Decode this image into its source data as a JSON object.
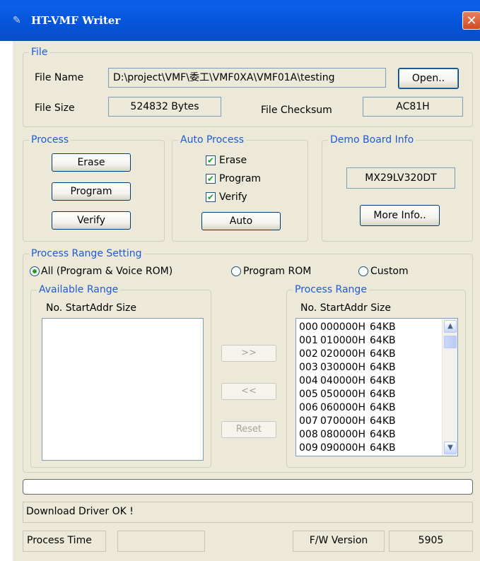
{
  "window": {
    "title": "HT-VMF Writer",
    "close_glyph": "✕",
    "app_icon": "writer-app-icon"
  },
  "file": {
    "legend": "File",
    "name_label": "File Name",
    "name_value": "D:\\project\\VMF\\委工\\VMF0XA\\VMF01A\\testing",
    "open_button": "Open..",
    "size_label": "File Size",
    "size_value": "524832 Bytes",
    "checksum_label": "File Checksum",
    "checksum_value": "AC81H"
  },
  "process": {
    "legend": "Process",
    "erase": "Erase",
    "program": "Program",
    "verify": "Verify"
  },
  "auto_process": {
    "legend": "Auto Process",
    "options": [
      {
        "label": "Erase",
        "checked": true
      },
      {
        "label": "Program",
        "checked": true
      },
      {
        "label": "Verify",
        "checked": true
      }
    ],
    "auto_button": "Auto"
  },
  "demo_board": {
    "legend": "Demo Board Info",
    "value": "MX29LV320DT",
    "more_button": "More Info.."
  },
  "range_setting": {
    "legend": "Process Range Setting",
    "radios": [
      {
        "label": "All (Program & Voice ROM)",
        "selected": true
      },
      {
        "label": "Program ROM",
        "selected": false
      },
      {
        "label": "Custom",
        "selected": false
      }
    ],
    "available": {
      "legend": "Available Range",
      "header": "No. StartAddr Size",
      "rows": []
    },
    "process": {
      "legend": "Process Range",
      "header": "No. StartAddr Size",
      "rows": [
        {
          "no": "000",
          "addr": "000000H",
          "size": "64KB"
        },
        {
          "no": "001",
          "addr": "010000H",
          "size": "64KB"
        },
        {
          "no": "002",
          "addr": "020000H",
          "size": "64KB"
        },
        {
          "no": "003",
          "addr": "030000H",
          "size": "64KB"
        },
        {
          "no": "004",
          "addr": "040000H",
          "size": "64KB"
        },
        {
          "no": "005",
          "addr": "050000H",
          "size": "64KB"
        },
        {
          "no": "006",
          "addr": "060000H",
          "size": "64KB"
        },
        {
          "no": "007",
          "addr": "070000H",
          "size": "64KB"
        },
        {
          "no": "008",
          "addr": "080000H",
          "size": "64KB"
        },
        {
          "no": "009",
          "addr": "090000H",
          "size": "64KB"
        }
      ]
    },
    "add_button": ">>",
    "remove_button": "<<",
    "reset_button": "Reset"
  },
  "progress": {
    "value": 0
  },
  "status": {
    "message": "Download Driver OK !"
  },
  "footer": {
    "process_time_label": "Process Time",
    "process_time_value": "",
    "fw_label": "F/W Version",
    "fw_value": "5905"
  },
  "colors": {
    "title_bar": "#0553d8",
    "legend_text": "#1e5ad8",
    "check": "#21a121"
  }
}
